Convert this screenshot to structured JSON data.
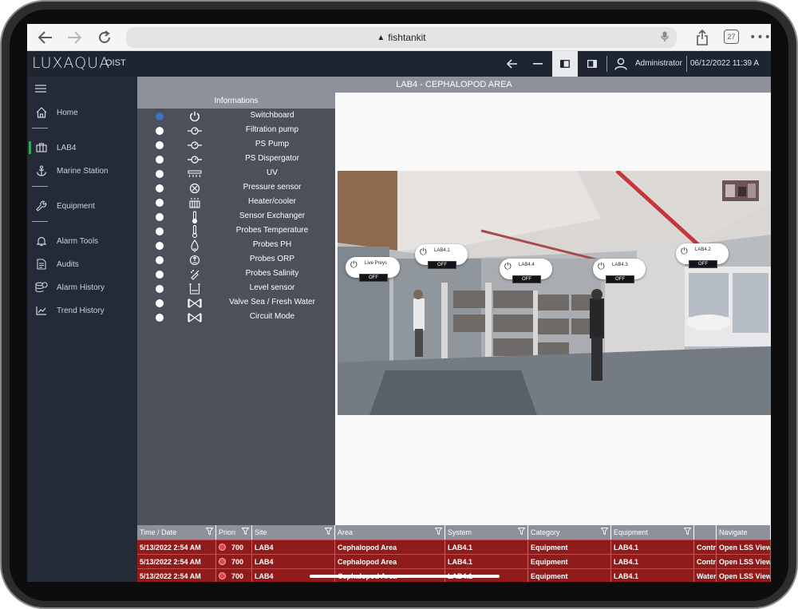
{
  "browser": {
    "url": "fishtankit",
    "tab_count": "27"
  },
  "header": {
    "logo": "LUXAQUA",
    "site": "OIST",
    "user": "Administrator",
    "datetime": "06/12/2022 11:39 A"
  },
  "sidebar": {
    "items": [
      {
        "label": "Home",
        "icon": "home-icon"
      },
      {
        "label": "LAB4",
        "icon": "building-icon"
      },
      {
        "label": "Marine Station",
        "icon": "anchor-icon"
      },
      {
        "label": "Equipment",
        "icon": "wrench-icon"
      },
      {
        "label": "Alarm Tools",
        "icon": "bell-icon"
      },
      {
        "label": "Audits",
        "icon": "document-icon"
      },
      {
        "label": "Alarm History",
        "icon": "database-clock-icon"
      },
      {
        "label": "Trend History",
        "icon": "trend-chart-icon"
      }
    ]
  },
  "area": {
    "title": "LAB4 - CEPHALOPOD AREA"
  },
  "informations": {
    "title": "Informations",
    "items": [
      {
        "label": "Switchboard",
        "icon": "power-icon",
        "selected": true
      },
      {
        "label": "Filtration pump",
        "icon": "pump-icon",
        "selected": false
      },
      {
        "label": "PS Pump",
        "icon": "pump-icon",
        "selected": false
      },
      {
        "label": "PS Dispergator",
        "icon": "pump-icon",
        "selected": false
      },
      {
        "label": "UV",
        "icon": "uv-lamp-icon",
        "selected": false
      },
      {
        "label": "Pressure sensor",
        "icon": "pressure-gauge-icon",
        "selected": false
      },
      {
        "label": "Heater/cooler",
        "icon": "heater-icon",
        "selected": false
      },
      {
        "label": "Sensor Exchanger",
        "icon": "thermometer-icon",
        "selected": false
      },
      {
        "label": "Probes Temperature",
        "icon": "thermometer-probe-icon",
        "selected": false
      },
      {
        "label": "Probes PH",
        "icon": "ph-probe-icon",
        "selected": false
      },
      {
        "label": "Probes ORP",
        "icon": "orp-probe-icon",
        "selected": false
      },
      {
        "label": "Probes Salinity",
        "icon": "salinity-probe-icon",
        "selected": false
      },
      {
        "label": "Level sensor",
        "icon": "level-sensor-icon",
        "selected": false
      },
      {
        "label": "Valve Sea / Fresh Water",
        "icon": "valve-icon",
        "selected": false
      },
      {
        "label": "Circuit Mode",
        "icon": "valve-icon",
        "selected": false
      }
    ]
  },
  "tags": [
    {
      "label": "Live Preys",
      "status": "OFF"
    },
    {
      "label": "LAB4.1",
      "status": "OFF"
    },
    {
      "label": "LAB4.4",
      "status": "OFF"
    },
    {
      "label": "LAB4.3",
      "status": "OFF"
    },
    {
      "label": "LAB4.2",
      "status": "OFF"
    }
  ],
  "alarms": {
    "columns": [
      "Time / Date",
      "Priori",
      "Site",
      "Area",
      "System",
      "Category",
      "Equipment",
      "",
      "Navigate"
    ],
    "rows": [
      [
        "5/13/2022 2:54 AM",
        "700",
        "LAB4",
        "Cephalopod Area",
        "LAB4.1",
        "Equipment",
        "LAB4.1",
        "Contr",
        "Open LSS View"
      ],
      [
        "5/13/2022 2:54 AM",
        "700",
        "LAB4",
        "Cephalopod Area",
        "LAB4.1",
        "Equipment",
        "LAB4.1",
        "Contr",
        "Open LSS View"
      ],
      [
        "5/13/2022 2:54 AM",
        "700",
        "LAB4",
        "Cephalopod Area",
        "LAB4.1",
        "Equipment",
        "LAB4.1",
        "Water",
        "Open LSS View"
      ]
    ]
  }
}
